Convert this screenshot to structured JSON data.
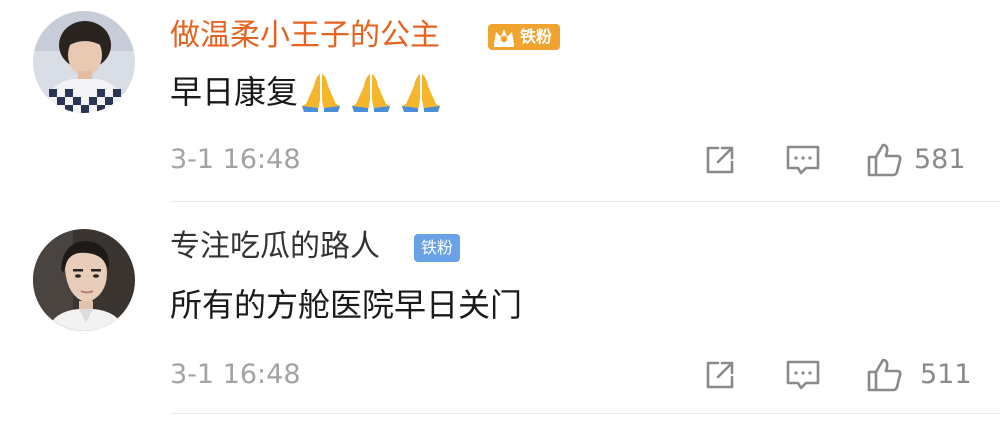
{
  "comments": [
    {
      "username": "做温柔小王子的公主",
      "badge": "铁粉",
      "text": "早日康复",
      "emoji": [
        "folded-hands",
        "folded-hands",
        "folded-hands"
      ],
      "time": "3-1 16:48",
      "likes": "581",
      "name_color": "#e5621f",
      "badge_color": "#f0a32e"
    },
    {
      "username": "专注吃瓜的路人",
      "badge": "铁粉",
      "text": "所有的方舱医院早日关门",
      "time": "3-1 16:48",
      "likes": "511",
      "name_color": "#333333",
      "badge_color": "#6aa2e8"
    }
  ],
  "icons": {
    "share": "share-icon",
    "reply": "comment-icon",
    "like": "thumbs-up-icon"
  }
}
